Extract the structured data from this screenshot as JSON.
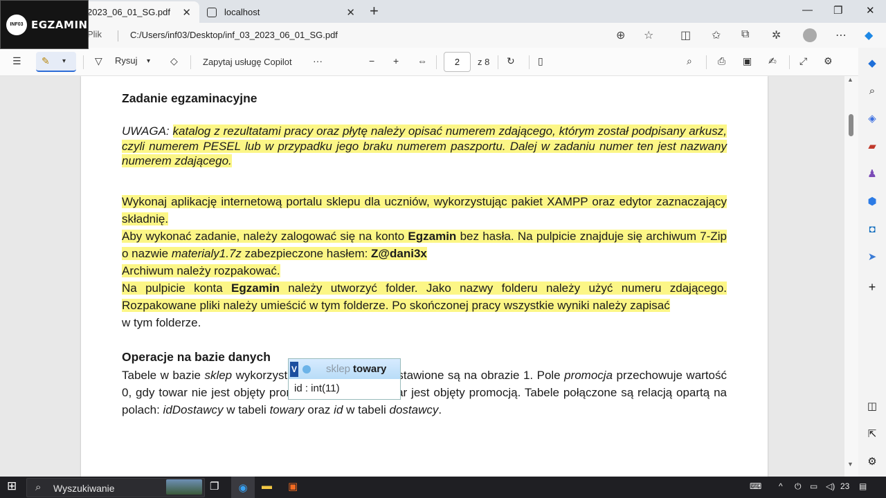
{
  "logo": {
    "badge": "INF03",
    "text": "EGZAMIN"
  },
  "tabs": [
    {
      "label": "2023_06_01_SG.pdf",
      "active": true
    },
    {
      "label": "localhost",
      "active": false
    }
  ],
  "address_bar": {
    "site_label": "Plik",
    "url": "C:/Users/inf03/Desktop/inf_03_2023_06_01_SG.pdf"
  },
  "pdf_toolbar": {
    "draw_label": "Rysuj",
    "copilot_label": "Zapytaj usługę Copilot",
    "more": "···",
    "zoom_out": "−",
    "zoom_in": "+",
    "current_page": "2",
    "total_pages": "z 8"
  },
  "document": {
    "heading1": "Zadanie egzaminacyjne",
    "uwaga_label": "UWAGA:",
    "uwaga_text": "katalog z rezultatami pracy oraz płytę należy opisać numerem zdającego, którym został podpisany arkusz, czyli numerem PESEL lub w przypadku jego braku numerem paszportu. Dalej w zadaniu numer ten jest nazwany numerem zdającego.",
    "p1": "Wykonaj aplikację internetową portalu sklepu dla uczniów, wykorzystując pakiet XAMPP oraz edytor zaznaczający składnię.",
    "p2_a": "Aby wykonać zadanie, należy zalogować się na konto ",
    "p2_b": "Egzamin",
    "p2_c": " bez hasła. Na pulpicie znajduje się archiwum 7-Zip o nazwie ",
    "p2_d": "materialy1.7z",
    "p2_e": " zabezpieczone hasłem: ",
    "p2_f": "Z@dani3x",
    "p3": "Archiwum należy rozpakować.",
    "p4_a": "Na pulpicie konta ",
    "p4_b": "Egzamin",
    "p4_c": " należy utworzyć folder. Jako nazwy folderu należy użyć numeru zdającego. Rozpakowane pliki należy umieścić w tym folderze. Po skończonej pracy wszystkie wyniki należy zapisać",
    "p4_d": "w tym folderze.",
    "heading2": "Operacje na bazie danych",
    "p5_a": "Tabele w bazie ",
    "p5_b": "sklep",
    "p5_c": " wykorzystane w zadaniu przedstawione są na obrazie 1. Pole ",
    "p5_d": "promocja",
    "p5_e": " przechowuje wartość 0, gdy towar nie jest objęty promocją lub 1, gdy towar jest objęty promocją. Tabele połączone są relacją opartą na polach: ",
    "p5_f": "idDostawcy",
    "p5_g": " w tabeli ",
    "p5_h": "towary",
    "p5_i": " oraz ",
    "p5_j": "id",
    "p5_k": " w tabeli ",
    "p5_l": "dostawcy",
    "p5_m": ".",
    "table": {
      "badge": "V",
      "db": "sklep",
      "name": "towary",
      "row1": "id : int(11)"
    }
  },
  "taskbar": {
    "search_placeholder": "Wyszukiwanie",
    "clock": "23"
  },
  "colors": {
    "highlight": "#fcf686",
    "accent": "#2b6bd6"
  }
}
